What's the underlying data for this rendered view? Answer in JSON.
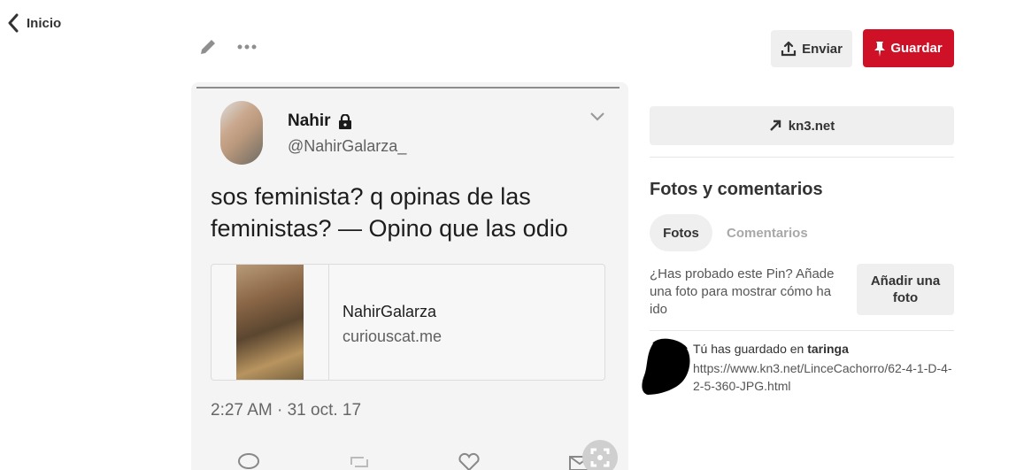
{
  "nav": {
    "back_label": "Inicio"
  },
  "toolbar": {
    "send_label": "Enviar",
    "save_label": "Guardar",
    "brand_color": "#cf1127"
  },
  "pin_image": {
    "tweet": {
      "name": "Nahir",
      "handle": "@NahirGalarza_",
      "text": "sos feminista? q opinas de las feministas? — Opino que las odio",
      "card_title": "NahirGalarza",
      "card_domain": "curiouscat.me",
      "timestamp": "2:27 AM · 31 oct. 17"
    }
  },
  "sidebar": {
    "link_label": "kn3.net",
    "section_title": "Fotos y comentarios",
    "tabs": [
      {
        "label": "Fotos",
        "active": true
      },
      {
        "label": "Comentarios",
        "active": false
      }
    ],
    "try_prompt": "¿Has probado este Pin? Añade una foto para mostrar cómo ha ido",
    "add_photo_label": "Añadir una foto",
    "saved_prefix": "Tú has guardado en ",
    "saved_board": "taringa",
    "saved_url": "https://www.kn3.net/LinceCachorro/62-4-1-D-4-2-5-360-JPG.html"
  }
}
